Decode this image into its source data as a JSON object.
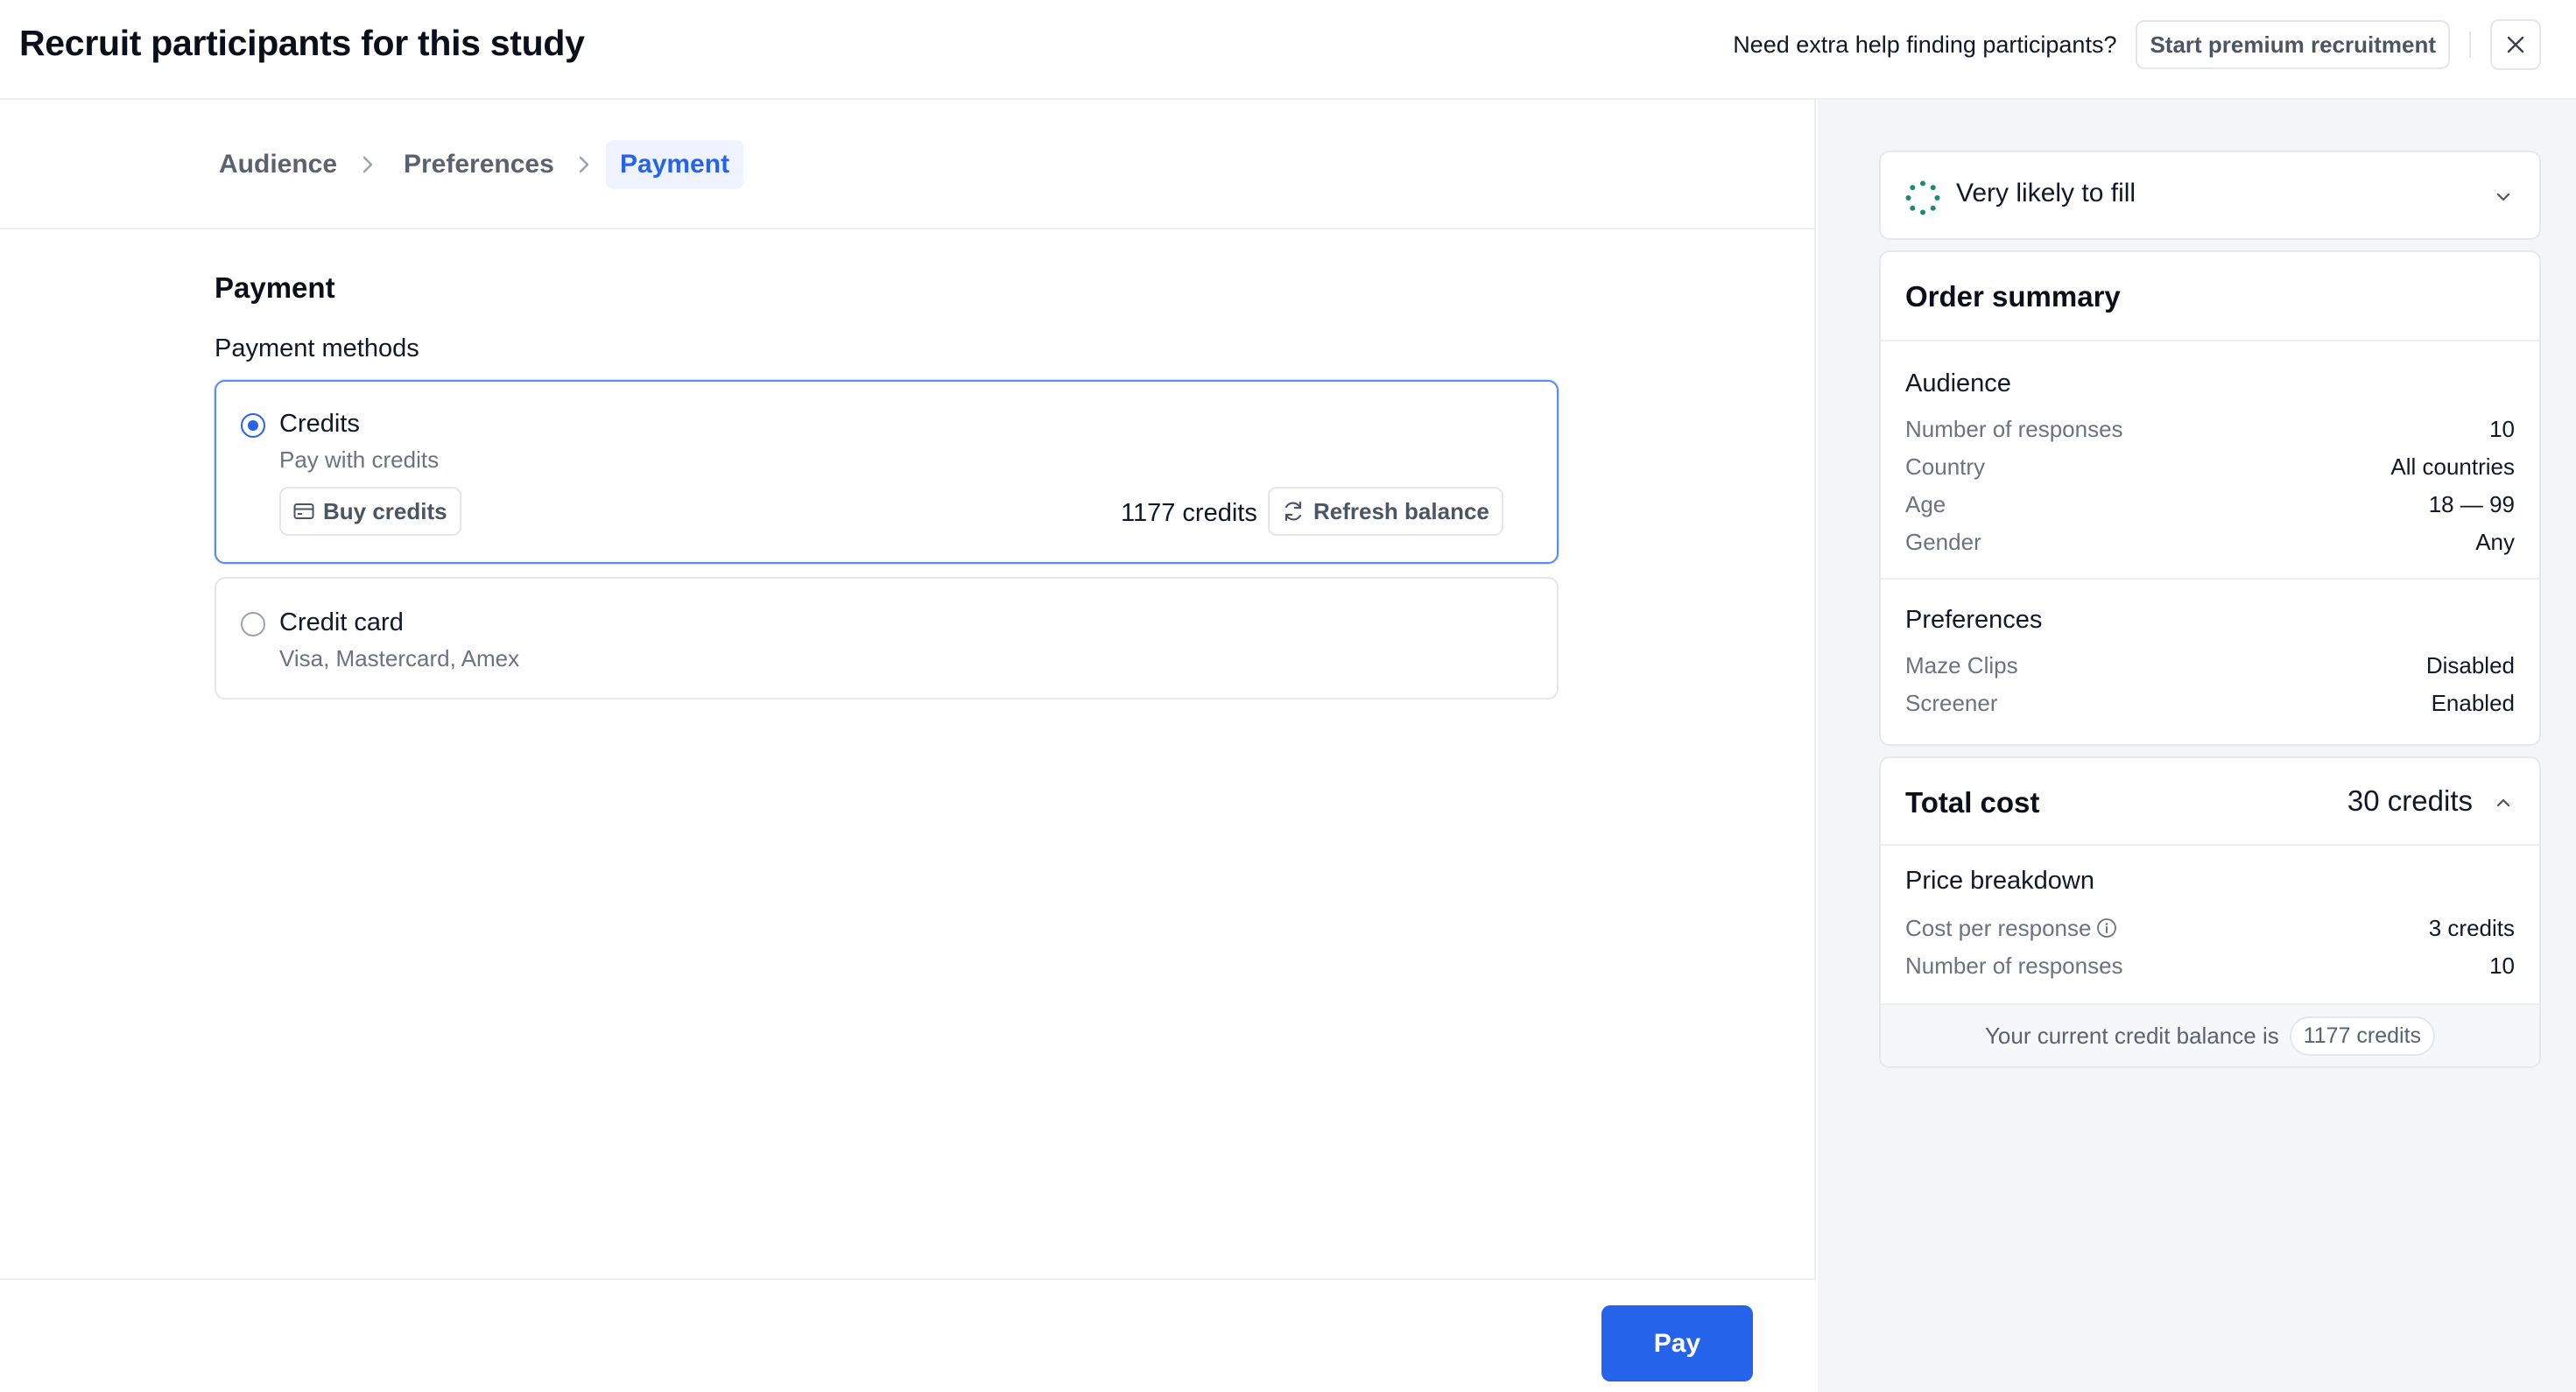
{
  "header": {
    "title": "Recruit participants for this study",
    "help_text": "Need extra help finding participants?",
    "premium_label": "Start premium recruitment"
  },
  "breadcrumb": {
    "items": [
      "Audience",
      "Preferences",
      "Payment"
    ],
    "active_index": 2
  },
  "payment": {
    "section_title": "Payment",
    "methods_label": "Payment methods",
    "methods": [
      {
        "title": "Credits",
        "subtitle": "Pay with credits",
        "selected": true,
        "buy_label": "Buy credits",
        "balance": "1177 credits",
        "refresh_label": "Refresh balance"
      },
      {
        "title": "Credit card",
        "subtitle": "Visa, Mastercard, Amex",
        "selected": false
      }
    ]
  },
  "footer": {
    "pay_label": "Pay"
  },
  "sidebar": {
    "fill_status": "Very likely to fill",
    "summary_title": "Order summary",
    "audience": {
      "title": "Audience",
      "rows": [
        {
          "label": "Number of responses",
          "value": "10"
        },
        {
          "label": "Country",
          "value": "All countries"
        },
        {
          "label": "Age",
          "value": "18 — 99"
        },
        {
          "label": "Gender",
          "value": "Any"
        }
      ]
    },
    "preferences": {
      "title": "Preferences",
      "rows": [
        {
          "label": "Maze Clips",
          "value": "Disabled"
        },
        {
          "label": "Screener",
          "value": "Enabled"
        }
      ]
    },
    "total": {
      "title": "Total cost",
      "amount": "30 credits",
      "breakdown_title": "Price breakdown",
      "rows": [
        {
          "label": "Cost per response",
          "value": "3 credits"
        },
        {
          "label": "Number of responses",
          "value": "10"
        }
      ],
      "balance_text": "Your current credit balance is",
      "balance_pill": "1177 credits"
    }
  },
  "colors": {
    "accent": "#2563eb",
    "fill_indicator": "#1f8a74"
  },
  "icons": [
    "close-icon",
    "chevron-right-icon",
    "credit-card-icon",
    "refresh-icon",
    "spinner-icon",
    "chevron-down-icon",
    "chevron-up-icon",
    "info-icon"
  ]
}
